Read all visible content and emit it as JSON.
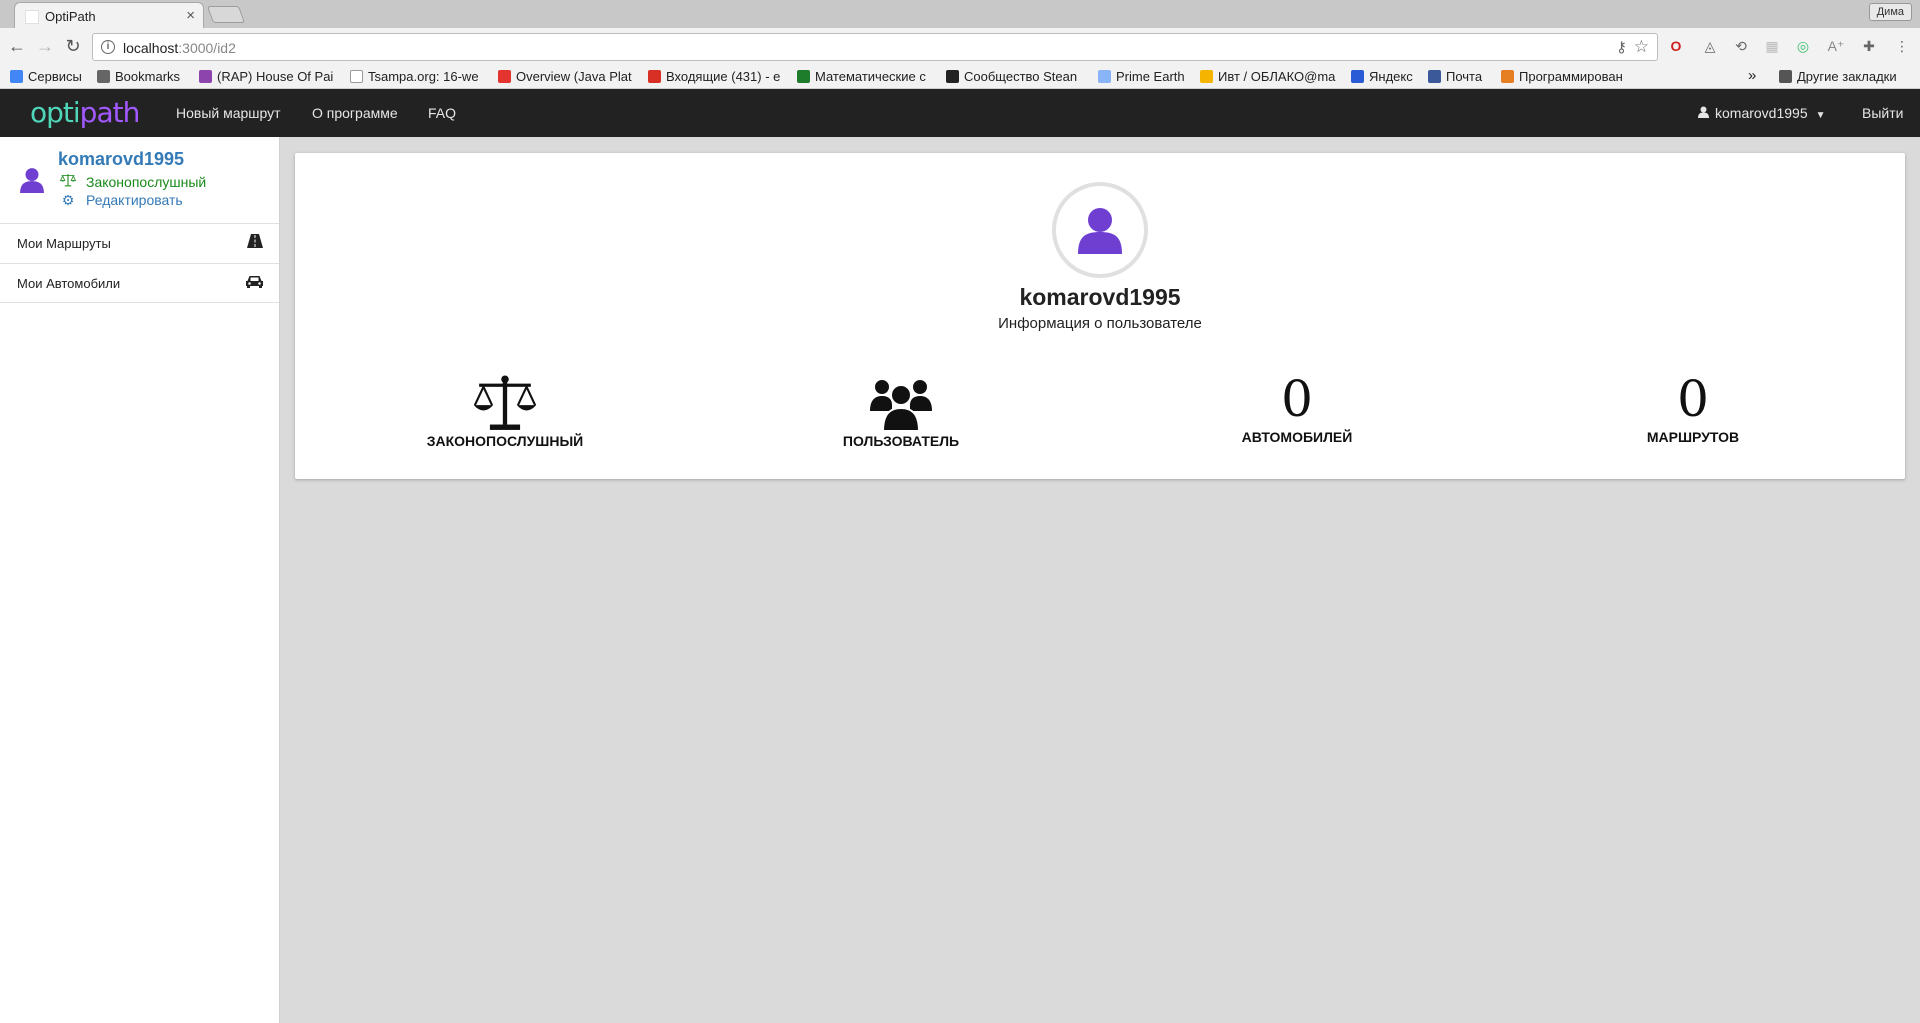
{
  "browser": {
    "tab_title": "OptiPath",
    "tab_close": "×",
    "profile_name": "Дима",
    "url_host": "localhost",
    "url_path": ":3000/id2",
    "bookmarks": [
      {
        "label": "Сервисы",
        "color": "#4285f4"
      },
      {
        "label": "Bookmarks",
        "color": "#666666"
      },
      {
        "label": "(RAP) House Of Pai",
        "color": "#8e44ad"
      },
      {
        "label": "Tsampa.org: 16-we",
        "color": "#999999"
      },
      {
        "label": "Overview (Java Plat",
        "color": "#e3342f"
      },
      {
        "label": "Входящие (431) - e",
        "color": "#d93025"
      },
      {
        "label": "Математические с",
        "color": "#1e7d2a"
      },
      {
        "label": "Сообщество Stean",
        "color": "#222222"
      },
      {
        "label": "Prime Earth",
        "color": "#8ab4f8"
      },
      {
        "label": "Ивт / ОБЛАКО@ma",
        "color": "#f5b400"
      },
      {
        "label": "Яндекс",
        "color": "#2a5bd7"
      },
      {
        "label": "Почта",
        "color": "#3b5998"
      },
      {
        "label": "Программирован",
        "color": "#e67e22"
      }
    ],
    "bookmarks_overflow": "»",
    "other_bookmarks": "Другие закладки"
  },
  "navbar": {
    "brand_part1": "opti",
    "brand_part2": "path",
    "links": [
      "Новый маршрут",
      "О программе",
      "FAQ"
    ],
    "username": "komarovd1995",
    "logout": "Выйти"
  },
  "sidebar": {
    "username": "komarovd1995",
    "status": "Законопослушный",
    "edit": "Редактировать",
    "items": [
      {
        "label": "Мои Маршруты",
        "icon": "road-icon"
      },
      {
        "label": "Мои Автомобили",
        "icon": "car-icon"
      }
    ]
  },
  "profile": {
    "username": "komarovd1995",
    "subtitle": "Информация о пользователе",
    "stats": [
      {
        "label": "ЗАКОНОПОСЛУШНЫЙ",
        "icon": "scales-icon"
      },
      {
        "label": "ПОЛЬЗОВАТЕЛЬ",
        "icon": "users-icon"
      },
      {
        "label": "АВТОМОБИЛЕЙ",
        "value": "0"
      },
      {
        "label": "МАРШРУТОВ",
        "value": "0"
      }
    ]
  },
  "colors": {
    "accent_purple": "#6f3fd1",
    "link_blue": "#337ab7",
    "status_green": "#1a8a1a",
    "navbar_bg": "#222222",
    "brand_teal": "#4fd6b8",
    "brand_purple": "#a259ff"
  }
}
